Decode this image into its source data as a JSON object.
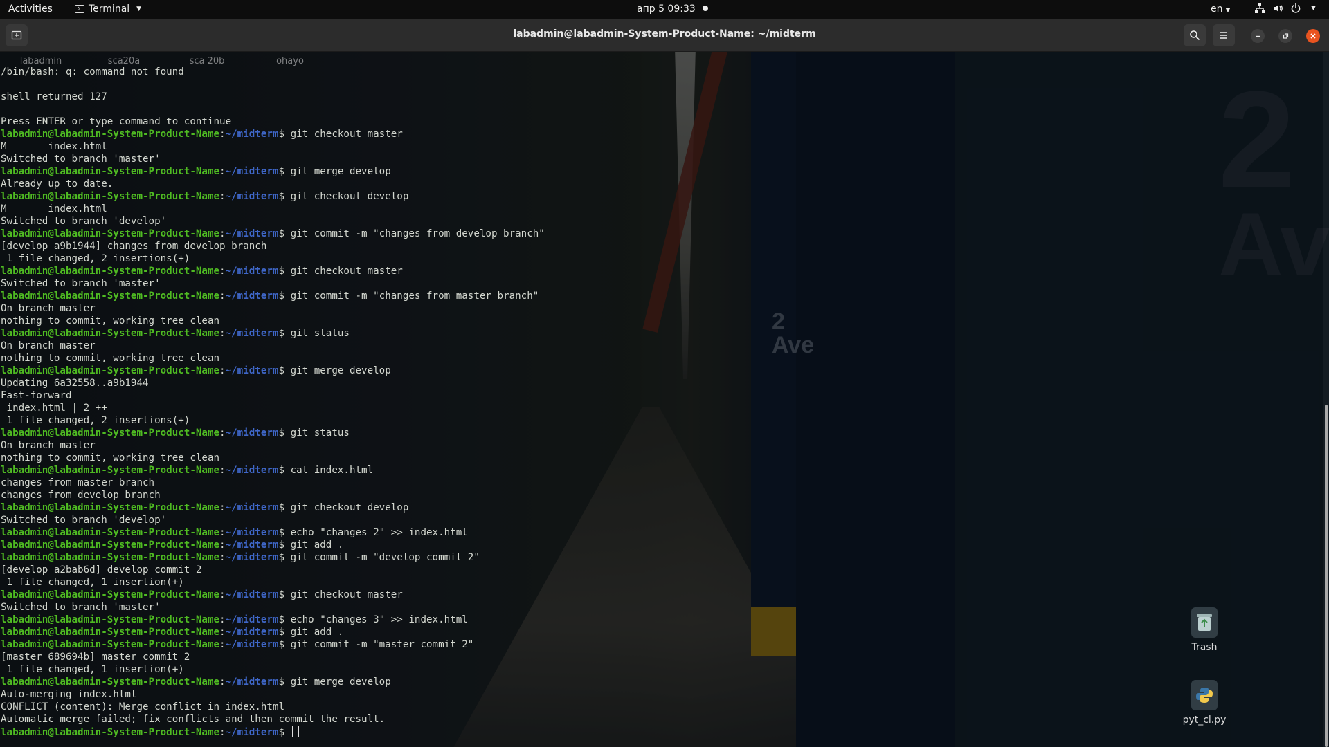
{
  "topbar": {
    "activities": "Activities",
    "app_name": "Terminal",
    "clock": "апр 5  09:33",
    "lang": "en"
  },
  "window": {
    "title": "labadmin@labadmin-System-Product-Name: ~/midterm"
  },
  "ghost_desktop_icons": [
    "labadmin",
    "sca20a",
    "sca 20b",
    "ohayo"
  ],
  "terminal": {
    "lines": [
      {
        "out": "/bin/bash: q: command not found"
      },
      {
        "out": ""
      },
      {
        "out": "shell returned 127"
      },
      {
        "out": ""
      },
      {
        "out": "Press ENTER or type command to continue"
      },
      {
        "user": "labadmin@labadmin-System-Product-Name",
        "path": "~/midterm",
        "cmd": "git checkout master"
      },
      {
        "out": "M\tindex.html"
      },
      {
        "out": "Switched to branch 'master'"
      },
      {
        "user": "labadmin@labadmin-System-Product-Name",
        "path": "~/midterm",
        "cmd": "git merge develop"
      },
      {
        "out": "Already up to date."
      },
      {
        "user": "labadmin@labadmin-System-Product-Name",
        "path": "~/midterm",
        "cmd": "git checkout develop"
      },
      {
        "out": "M\tindex.html"
      },
      {
        "out": "Switched to branch 'develop'"
      },
      {
        "user": "labadmin@labadmin-System-Product-Name",
        "path": "~/midterm",
        "cmd": "git commit -m \"changes from develop branch\""
      },
      {
        "out": "[develop a9b1944] changes from develop branch"
      },
      {
        "out": " 1 file changed, 2 insertions(+)"
      },
      {
        "user": "labadmin@labadmin-System-Product-Name",
        "path": "~/midterm",
        "cmd": "git checkout master"
      },
      {
        "out": "Switched to branch 'master'"
      },
      {
        "user": "labadmin@labadmin-System-Product-Name",
        "path": "~/midterm",
        "cmd": "git commit -m \"changes from master branch\""
      },
      {
        "out": "On branch master"
      },
      {
        "out": "nothing to commit, working tree clean"
      },
      {
        "user": "labadmin@labadmin-System-Product-Name",
        "path": "~/midterm",
        "cmd": "git status"
      },
      {
        "out": "On branch master"
      },
      {
        "out": "nothing to commit, working tree clean"
      },
      {
        "user": "labadmin@labadmin-System-Product-Name",
        "path": "~/midterm",
        "cmd": "git merge develop"
      },
      {
        "out": "Updating 6a32558..a9b1944"
      },
      {
        "out": "Fast-forward"
      },
      {
        "out": " index.html | 2 ++"
      },
      {
        "out": " 1 file changed, 2 insertions(+)"
      },
      {
        "user": "labadmin@labadmin-System-Product-Name",
        "path": "~/midterm",
        "cmd": "git status"
      },
      {
        "out": "On branch master"
      },
      {
        "out": "nothing to commit, working tree clean"
      },
      {
        "user": "labadmin@labadmin-System-Product-Name",
        "path": "~/midterm",
        "cmd": "cat index.html"
      },
      {
        "out": "changes from master branch"
      },
      {
        "out": "changes from develop branch"
      },
      {
        "user": "labadmin@labadmin-System-Product-Name",
        "path": "~/midterm",
        "cmd": "git checkout develop"
      },
      {
        "out": "Switched to branch 'develop'"
      },
      {
        "user": "labadmin@labadmin-System-Product-Name",
        "path": "~/midterm",
        "cmd": "echo \"changes 2\" >> index.html"
      },
      {
        "user": "labadmin@labadmin-System-Product-Name",
        "path": "~/midterm",
        "cmd": "git add ."
      },
      {
        "user": "labadmin@labadmin-System-Product-Name",
        "path": "~/midterm",
        "cmd": "git commit -m \"develop commit 2\""
      },
      {
        "out": "[develop a2bab6d] develop commit 2"
      },
      {
        "out": " 1 file changed, 1 insertion(+)"
      },
      {
        "user": "labadmin@labadmin-System-Product-Name",
        "path": "~/midterm",
        "cmd": "git checkout master"
      },
      {
        "out": "Switched to branch 'master'"
      },
      {
        "user": "labadmin@labadmin-System-Product-Name",
        "path": "~/midterm",
        "cmd": "echo \"changes 3\" >> index.html"
      },
      {
        "user": "labadmin@labadmin-System-Product-Name",
        "path": "~/midterm",
        "cmd": "git add ."
      },
      {
        "user": "labadmin@labadmin-System-Product-Name",
        "path": "~/midterm",
        "cmd": "git commit -m \"master commit 2\""
      },
      {
        "out": "[master 689694b] master commit 2"
      },
      {
        "out": " 1 file changed, 1 insertion(+)"
      },
      {
        "user": "labadmin@labadmin-System-Product-Name",
        "path": "~/midterm",
        "cmd": "git merge develop"
      },
      {
        "out": "Auto-merging index.html"
      },
      {
        "out": "CONFLICT (content): Merge conflict in index.html"
      },
      {
        "out": "Automatic merge failed; fix conflicts and then commit the result."
      },
      {
        "user": "labadmin@labadmin-System-Product-Name",
        "path": "~/midterm",
        "cmd": "",
        "cursor": true
      }
    ]
  },
  "desktop_icons": [
    {
      "label": "Trash",
      "icon": "trash-icon"
    },
    {
      "label": "pyt_cl.py",
      "icon": "python-file-icon"
    }
  ],
  "wallpaper": {
    "sign_big_number": "2",
    "sign_big_text": "Ave",
    "sign_small": "2\nAve"
  },
  "colors": {
    "prompt_user": "#4fbb22",
    "prompt_path": "#3f67c9",
    "text": "#d3d7cf",
    "close_button": "#e95420"
  }
}
